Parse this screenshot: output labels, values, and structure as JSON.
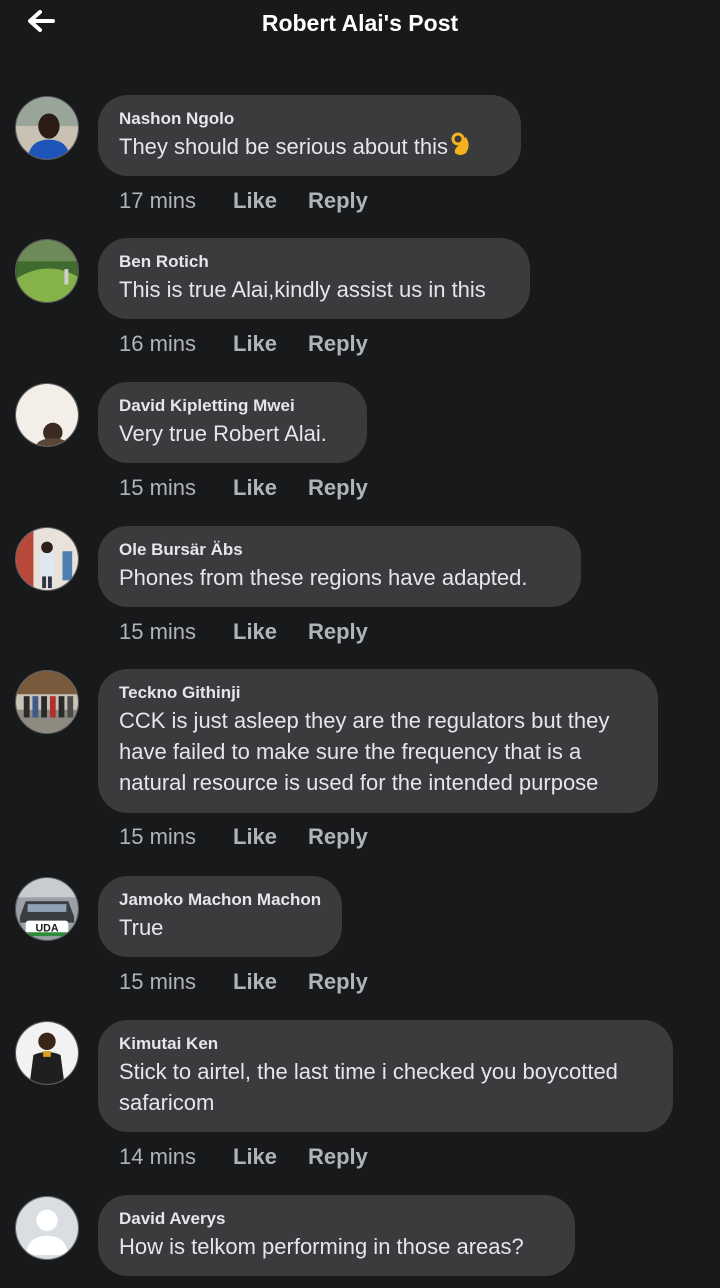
{
  "header": {
    "title": "Robert Alai's Post",
    "back_icon": "arrow-left-icon"
  },
  "actions": {
    "like": "Like",
    "reply": "Reply"
  },
  "comments": [
    {
      "author": "Nashon Ngolo",
      "text": "They should be serious about this",
      "time": "17 mins",
      "emoji": "ok-hand-emoji"
    },
    {
      "author": "Ben Rotich",
      "text": "This is true Alai,kindly assist us in this",
      "time": "16 mins"
    },
    {
      "author": "David Kipletting Mwei",
      "text": "Very true Robert Alai.",
      "time": "15 mins"
    },
    {
      "author": "Ole Bursär Äbs",
      "text": "Phones from these regions have adapted.",
      "time": "15 mins"
    },
    {
      "author": "Teckno Githinji",
      "text": "CCK is just asleep they are the regulators but they have failed to make sure the frequency that is a natural resource is used for the intended purpose",
      "time": "15 mins"
    },
    {
      "author": "Jamoko Machon Machon",
      "text": "True",
      "time": "15 mins",
      "avatar_text": "UDA"
    },
    {
      "author": "Kimutai Ken",
      "text": "Stick to airtel, the last time i checked you boycotted safaricom",
      "time": "14 mins"
    },
    {
      "author": "David Averys",
      "text": "How is telkom performing in those areas?",
      "time": ""
    }
  ],
  "colors": {
    "background": "#18191a",
    "bubble": "#3a3b3c",
    "primary_text": "#e4e6eb",
    "secondary_text": "#b0b3b8"
  }
}
